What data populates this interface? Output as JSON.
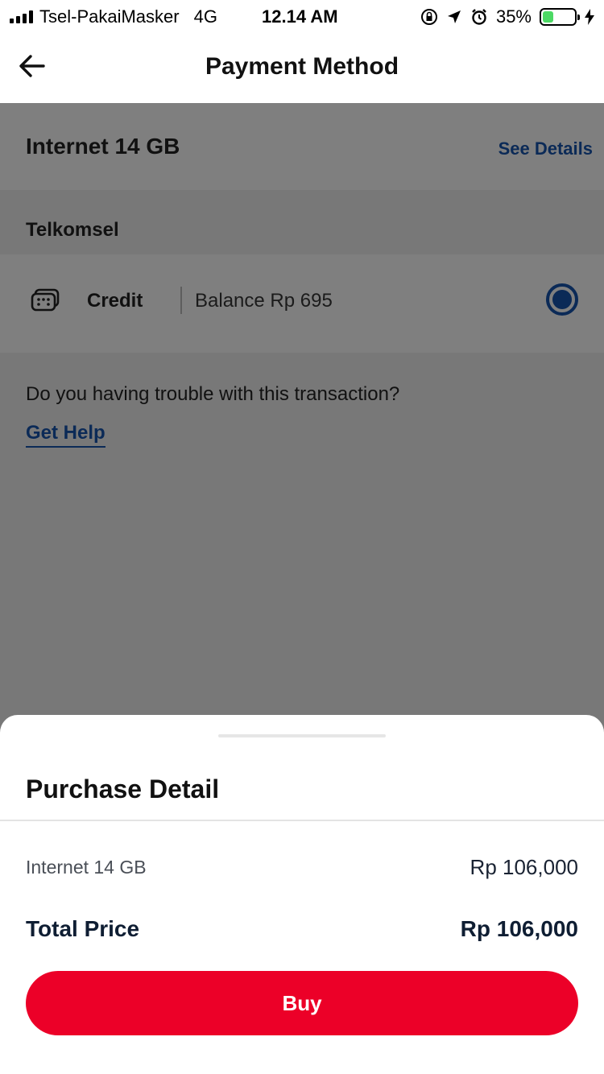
{
  "status_bar": {
    "carrier": "Tsel-PakaiMasker",
    "network": "4G",
    "time": "12.14 AM",
    "battery_percent": "35%",
    "battery_level": 0.35,
    "icons": [
      "signal-icon",
      "orientation-lock-icon",
      "location-arrow-icon",
      "alarm-icon",
      "battery-icon",
      "charging-bolt-icon"
    ]
  },
  "header": {
    "title": "Payment Method",
    "back_icon": "arrow-left-icon"
  },
  "package": {
    "name": "Internet 14 GB",
    "see_details": "See Details"
  },
  "provider": {
    "label": "Telkomsel"
  },
  "payment_option": {
    "icon": "sim-card-icon",
    "label": "Credit",
    "balance": "Balance Rp 695",
    "selected": true
  },
  "help": {
    "text": "Do you having trouble with this transaction?",
    "link": "Get Help"
  },
  "purchase_detail": {
    "title": "Purchase Detail",
    "item_name": "Internet 14 GB",
    "item_price": "Rp 106,000",
    "total_label": "Total Price",
    "total_price": "Rp 106,000",
    "buy_label": "Buy"
  },
  "colors": {
    "accent_blue": "#0b2a57",
    "buy_red": "#ec0028",
    "overlay": "#787878"
  }
}
